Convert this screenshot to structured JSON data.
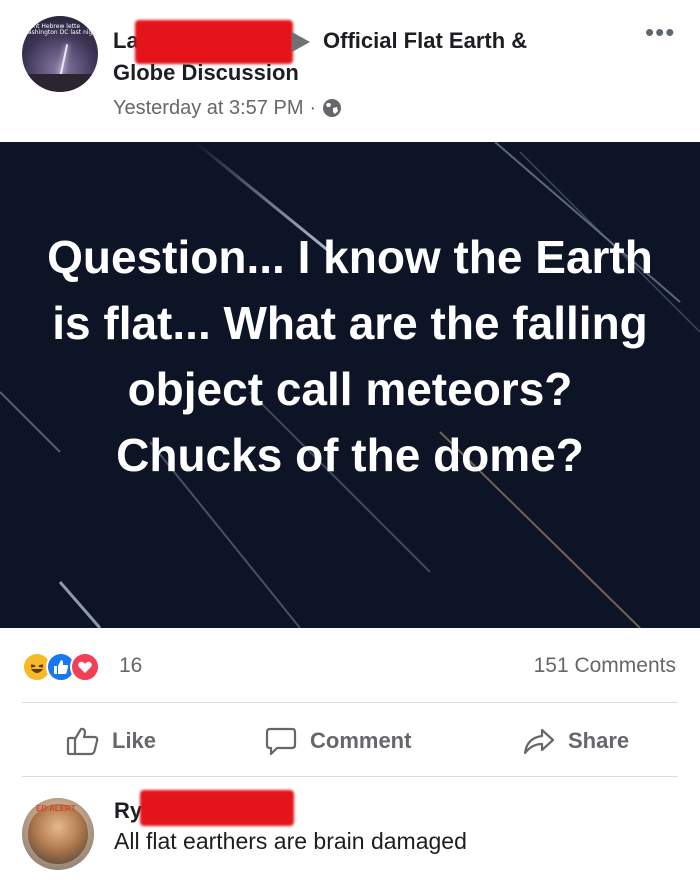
{
  "post": {
    "author_visible": "La",
    "group_name_line1": "Official Flat Earth &",
    "group_name_line2": "Globe Discussion",
    "timestamp": "Yesterday at 3:57 PM",
    "separator": "·",
    "privacy_icon": "globe-icon",
    "more_icon": "more-options-icon",
    "more_glyph": "•••",
    "avatar_overlay_text_1": "ient Hebrew lette",
    "avatar_overlay_text_2": "ashington DC last nigh",
    "image_caption": "Question... I know the Earth is flat... What are the falling object call meteors? Chucks of the dome?"
  },
  "engagement": {
    "reaction_icons": [
      "haha-reaction-icon",
      "like-reaction-icon",
      "love-reaction-icon"
    ],
    "reaction_count": "16",
    "comments_count": "151 Comments"
  },
  "actions": {
    "like_label": "Like",
    "comment_label": "Comment",
    "share_label": "Share"
  },
  "comment": {
    "author_visible": "Ry",
    "text": "All flat earthers are brain damaged",
    "avatar_ring_text": "ED ALERT"
  },
  "colors": {
    "facebook_blue": "#1877f2",
    "redaction_red": "#e3141a",
    "secondary_text": "#65676b",
    "image_background": "#0d1426"
  }
}
